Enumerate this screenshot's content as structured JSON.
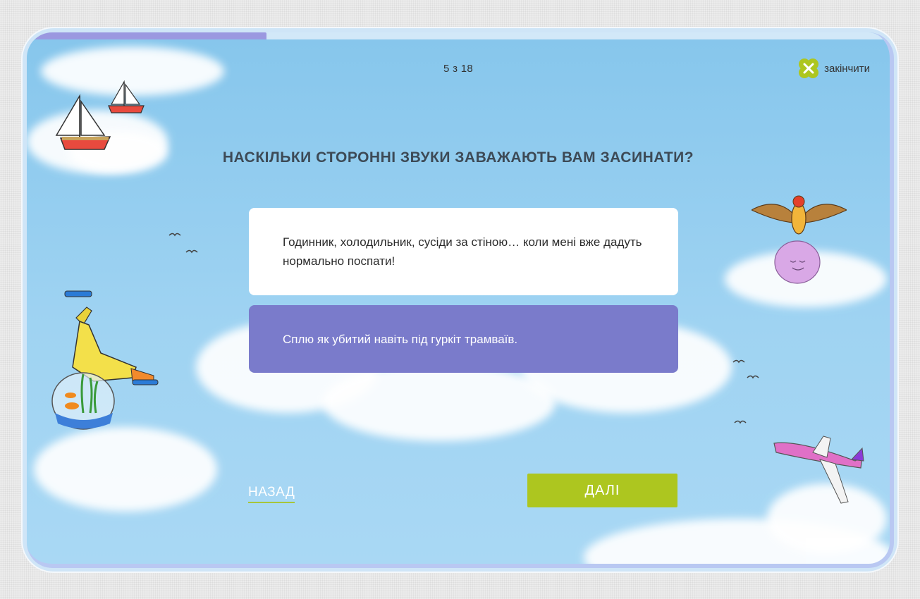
{
  "progress": {
    "counter_text": "5 з 18",
    "fraction": 0.2778
  },
  "header": {
    "finish_label": "закінчити",
    "finish_icon": "close-cross-icon"
  },
  "question": {
    "title": "НАСКІЛЬКИ СТОРОННІ ЗВУКИ ЗАВАЖАЮТЬ ВАМ ЗАСИНАТИ?"
  },
  "options": [
    {
      "text": "Годинник, холодильник, сусіди за стіною… коли мені вже дадуть нормально поспати!",
      "selected": false
    },
    {
      "text": "Сплю як убитий навіть під гуркіт трамваїв.",
      "selected": true
    }
  ],
  "navigation": {
    "back_label": "НАЗАД",
    "next_label": "ДАЛІ"
  },
  "colors": {
    "accent_green": "#adc61f",
    "selected_option": "#7a7bcb",
    "progress_fill": "#9b98e0",
    "sky": "#9fd3f2"
  }
}
